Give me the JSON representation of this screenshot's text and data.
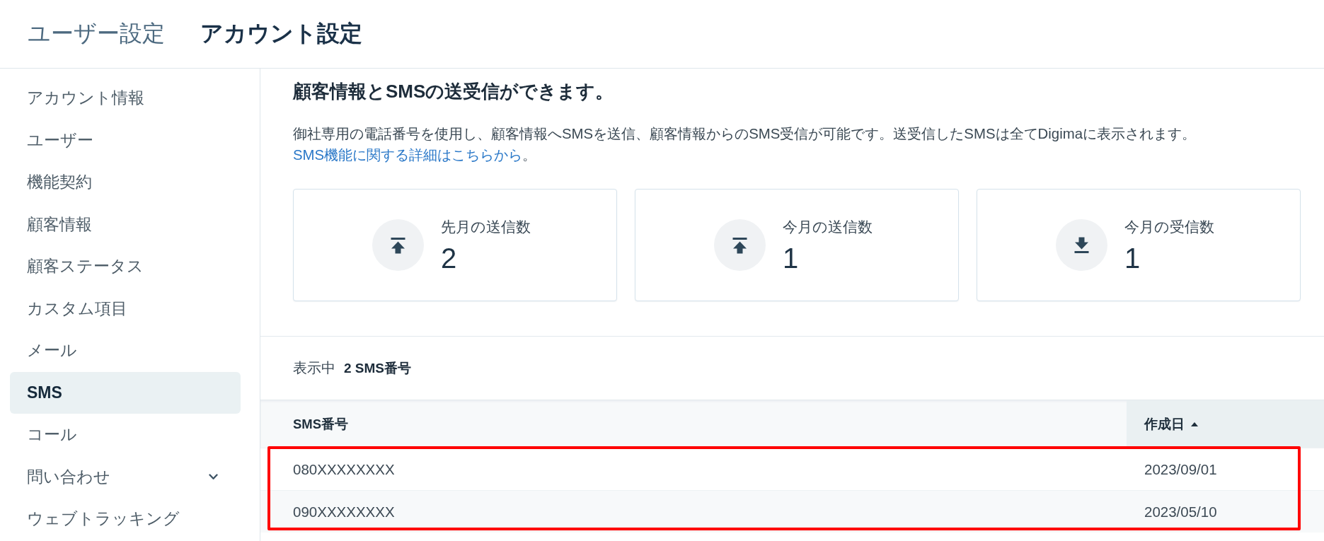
{
  "header": {
    "section": "ユーザー設定",
    "title": "アカウント設定"
  },
  "sidebar": {
    "items": [
      {
        "label": "アカウント情報",
        "selected": false,
        "has_submenu": false
      },
      {
        "label": "ユーザー",
        "selected": false,
        "has_submenu": false
      },
      {
        "label": "機能契約",
        "selected": false,
        "has_submenu": false
      },
      {
        "label": "顧客情報",
        "selected": false,
        "has_submenu": false
      },
      {
        "label": "顧客ステータス",
        "selected": false,
        "has_submenu": false
      },
      {
        "label": "カスタム項目",
        "selected": false,
        "has_submenu": false
      },
      {
        "label": "メール",
        "selected": false,
        "has_submenu": false
      },
      {
        "label": "SMS",
        "selected": true,
        "has_submenu": false
      },
      {
        "label": "コール",
        "selected": false,
        "has_submenu": false
      },
      {
        "label": "問い合わせ",
        "selected": false,
        "has_submenu": true
      },
      {
        "label": "ウェブトラッキング",
        "selected": false,
        "has_submenu": false
      }
    ]
  },
  "intro": {
    "title": "顧客情報とSMSの送受信ができます。",
    "description": "御社専用の電話番号を使用し、顧客情報へSMSを送信、顧客情報からのSMS受信が可能です。送受信したSMSは全てDigimaに表示されます。 ",
    "link": "SMS機能に関する詳細はこちらから",
    "description_end": "。"
  },
  "stats": [
    {
      "kind": "sent",
      "label": "先月の送信数",
      "value": "2"
    },
    {
      "kind": "sent",
      "label": "今月の送信数",
      "value": "1"
    },
    {
      "kind": "received",
      "label": "今月の受信数",
      "value": "1"
    }
  ],
  "table": {
    "summary_label": "表示中",
    "summary_count": "2 SMS番号",
    "columns": [
      {
        "label": "SMS番号",
        "sorted": false
      },
      {
        "label": "作成日",
        "sorted": true
      }
    ],
    "rows": [
      [
        "080XXXXXXXX",
        "2023/09/01"
      ],
      [
        "090XXXXXXXX",
        "2023/05/10"
      ]
    ],
    "highlighted": true
  }
}
